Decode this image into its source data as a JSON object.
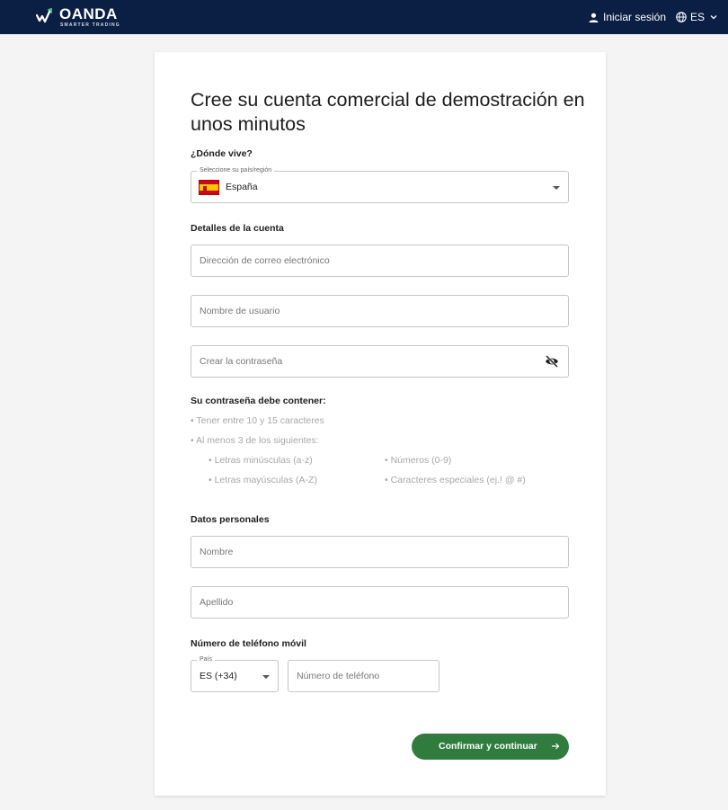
{
  "header": {
    "logo_text": "OANDA",
    "logo_tagline": "SMARTER TRADING",
    "login_label": "Iniciar sesión",
    "language_label": "ES"
  },
  "form": {
    "title": "Cree su cuenta comercial de demostración en unos minutos",
    "residence_label": "¿Dónde vive?",
    "country_legend": "Seleccione su país/región",
    "country_value": "España",
    "account_details_label": "Detalles de la cuenta",
    "email_placeholder": "Dirección de correo electrónico",
    "username_placeholder": "Nombre de usuario",
    "password_placeholder": "Crear la contraseña",
    "password_rules": {
      "title": "Su contraseña debe contener:",
      "length": "• Tener entre 10 y 15 caracteres",
      "at_least": "• Al menos 3 de los siguientes:",
      "lowercase": "• Letras minúsculas (a-z)",
      "uppercase": "• Letras mayúsculas (A-Z)",
      "numbers": "• Números (0-9)",
      "special": "• Caracteres especiales (ej.! @ #)"
    },
    "personal_label": "Datos personales",
    "first_name_placeholder": "Nombre",
    "last_name_placeholder": "Apellido",
    "phone_label": "Número de teléfono móvil",
    "prefix_legend": "País",
    "prefix_value": "ES (+34)",
    "phone_placeholder": "Número de teléfono",
    "submit_label": "Confirmar y continuar"
  },
  "colors": {
    "header_bg": "#0b1f45",
    "accent_green": "#2f7c3e",
    "logo_green": "#3fbf6f"
  }
}
